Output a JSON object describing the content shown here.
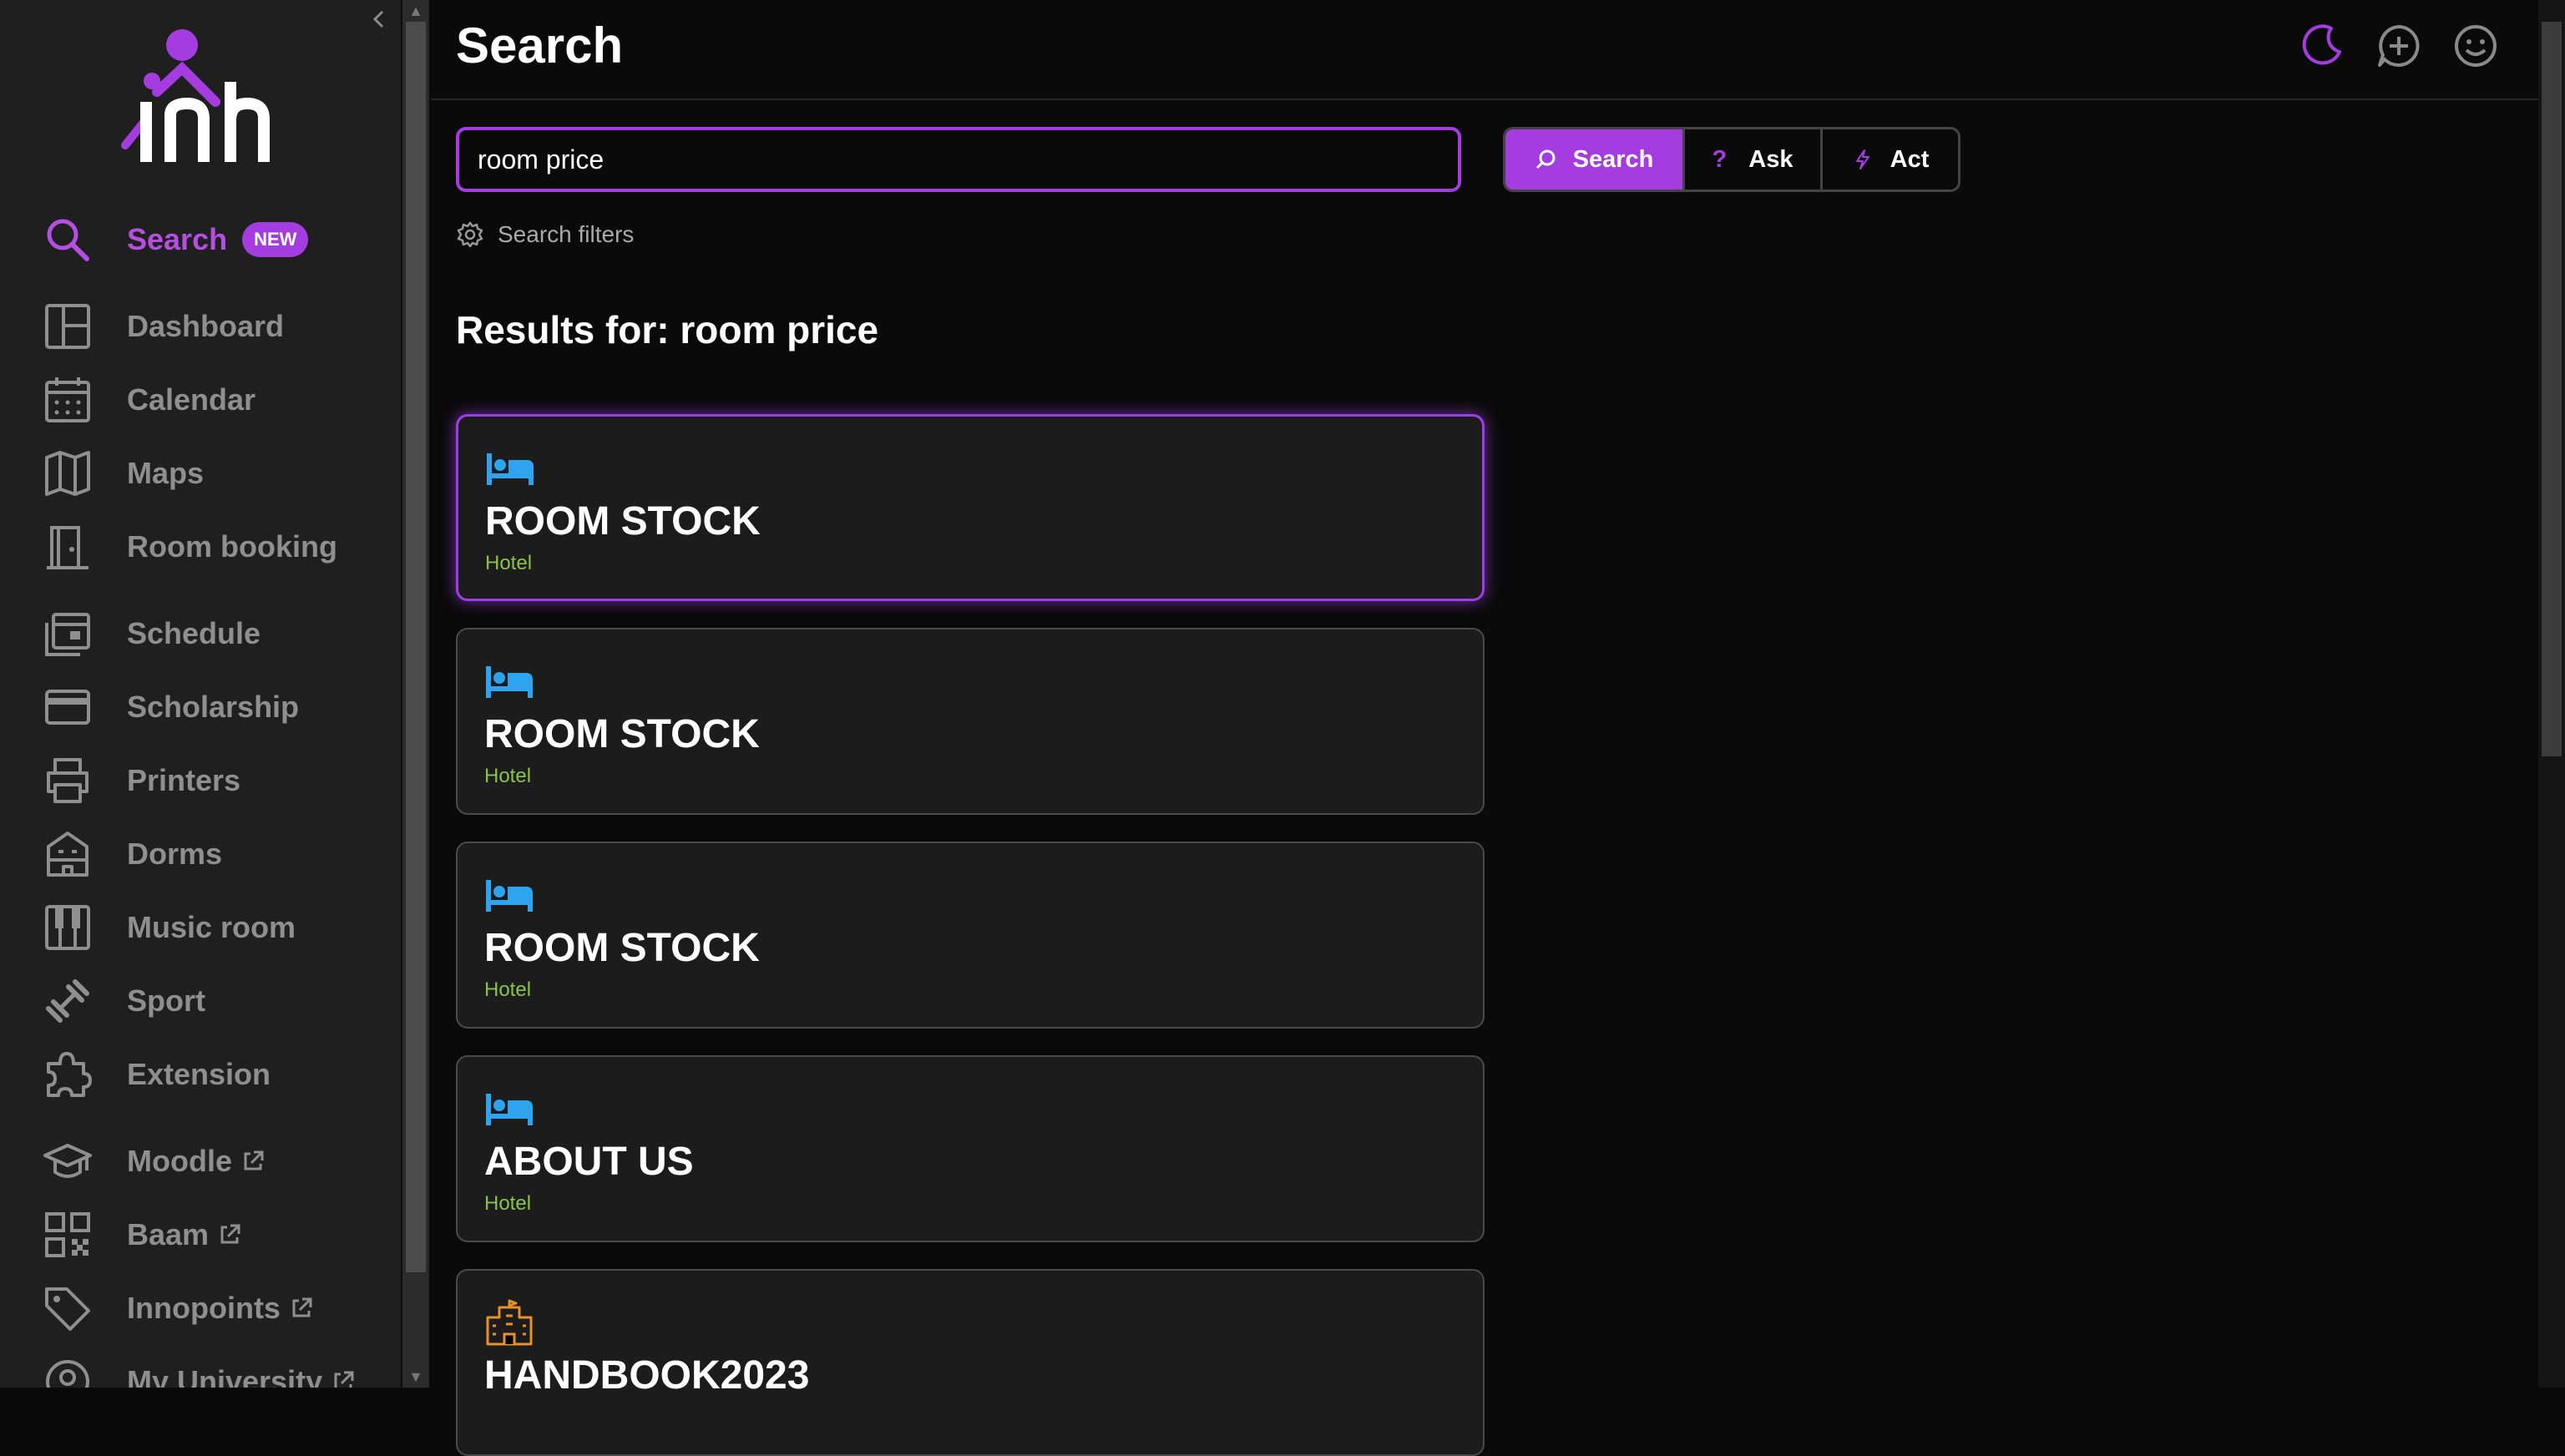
{
  "sidebar": {
    "search": {
      "label": "Search",
      "badge": "NEW"
    },
    "items": [
      {
        "label": "Dashboard"
      },
      {
        "label": "Calendar"
      },
      {
        "label": "Maps"
      },
      {
        "label": "Room booking"
      },
      {
        "label": "Schedule"
      },
      {
        "label": "Scholarship"
      },
      {
        "label": "Printers"
      },
      {
        "label": "Dorms"
      },
      {
        "label": "Music room"
      },
      {
        "label": "Sport"
      },
      {
        "label": "Extension"
      },
      {
        "label": "Moodle"
      },
      {
        "label": "Baam"
      },
      {
        "label": "Innopoints"
      },
      {
        "label": "My University"
      }
    ]
  },
  "header": {
    "title": "Search"
  },
  "search": {
    "value": "room price",
    "filters_label": "Search filters"
  },
  "modes": {
    "search": "Search",
    "ask": "Ask",
    "act": "Act"
  },
  "results": {
    "heading": "Results for: room price",
    "items": [
      {
        "title": "ROOM STOCK",
        "category": "Hotel",
        "icon": "bed-icon"
      },
      {
        "title": "ROOM STOCK",
        "category": "Hotel",
        "icon": "bed-icon"
      },
      {
        "title": "ROOM STOCK",
        "category": "Hotel",
        "icon": "bed-icon"
      },
      {
        "title": "ABOUT US",
        "category": "Hotel",
        "icon": "bed-icon"
      },
      {
        "title": "HANDBOOK2023",
        "category": "",
        "icon": "building-icon"
      }
    ]
  },
  "colors": {
    "accent": "#a53cdf",
    "bed_icon": "#2ea3ee",
    "category": "#8bc34a",
    "building_icon": "#e8902a"
  }
}
